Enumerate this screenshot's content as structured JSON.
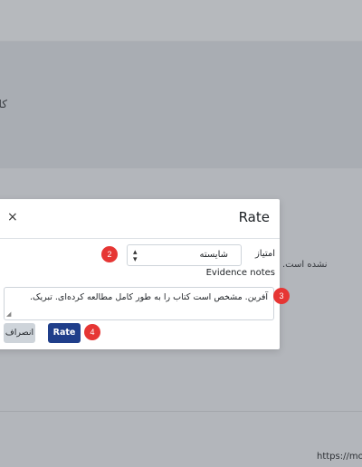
{
  "background": {
    "frag_1": "کا",
    "frag_2": "نشده است.",
    "frag_3": "https://moo"
  },
  "modal": {
    "title": "Rate",
    "close_glyph": "×",
    "rating_label": "امتیاز",
    "rating_value": "شایسته",
    "evidence_label": "Evidence notes",
    "evidence_text": "آفرین. مشخص است کتاب را به طور کامل مطالعه کرده‌ای. تبریک.",
    "cancel_label": "انصراف",
    "rate_label": "Rate"
  },
  "badges": {
    "b2": "2",
    "b3": "3",
    "b4": "4"
  },
  "colors": {
    "badge": "#e63634",
    "primary": "#1f3e8a",
    "overlay": "#b3b6bb"
  }
}
